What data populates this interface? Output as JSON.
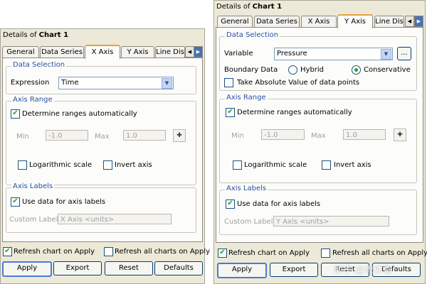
{
  "left": {
    "title_prefix": "Details of ",
    "title_bold": "Chart 1",
    "tabs": [
      "General",
      "Data Series",
      "X Axis",
      "Y Axis",
      "Line Dis"
    ],
    "active_tab": "X Axis",
    "data_selection": {
      "title": "Data Selection",
      "expression_label": "Expression",
      "expression_value": "Time"
    },
    "axis_range": {
      "title": "Axis Range",
      "auto_label": "Determine ranges automatically",
      "min_label": "Min",
      "min_value": "-1.0",
      "max_label": "Max",
      "max_value": "1.0",
      "log_label": "Logarithmic scale",
      "invert_label": "Invert axis"
    },
    "axis_labels": {
      "title": "Axis Labels",
      "use_data_label": "Use data for axis labels",
      "custom_label": "Custom Label",
      "custom_placeholder": "X Axis <units>"
    },
    "bottom": {
      "refresh_label": "Refresh chart on Apply",
      "refresh_all_label": "Refresh all charts on Apply",
      "apply": "Apply",
      "export": "Export",
      "reset": "Reset",
      "defaults": "Defaults"
    }
  },
  "right": {
    "title_prefix": "Details of ",
    "title_bold": "Chart 1",
    "tabs": [
      "General",
      "Data Series",
      "X Axis",
      "Y Axis",
      "Line Dis"
    ],
    "active_tab": "Y Axis",
    "data_selection": {
      "title": "Data Selection",
      "variable_label": "Variable",
      "variable_value": "Pressure",
      "ellipsis": "...",
      "boundary_label": "Boundary Data",
      "hybrid_label": "Hybrid",
      "conservative_label": "Conservative",
      "absolute_label": "Take Absolute Value of data points"
    },
    "axis_range": {
      "title": "Axis Range",
      "auto_label": "Determine ranges automatically",
      "min_label": "Min",
      "min_value": "-1.0",
      "max_label": "Max",
      "max_value": "1.0",
      "log_label": "Logarithmic scale",
      "invert_label": "Invert axis"
    },
    "axis_labels": {
      "title": "Axis Labels",
      "use_data_label": "Use data for axis labels",
      "custom_label": "Custom Label",
      "custom_placeholder": "Y Axis <units>"
    },
    "bottom": {
      "refresh_label": "Refresh chart on Apply",
      "refresh_all_label": "Refresh all charts on Apply",
      "apply": "Apply",
      "export": "Export",
      "reset": "Reset",
      "defaults": "Defaults"
    }
  },
  "watermark": "知乎 @流体智",
  "colors": {
    "panel_bg": "#ece9d8",
    "group_title": "#2a50a8",
    "check_mark": "#21a121",
    "active_tab_accent": "#e8a33c"
  },
  "icons": {
    "checkbox_checked": "✔",
    "dropdown": "▼",
    "tab_prev": "◀",
    "tab_next": "▶",
    "pick": "✚"
  }
}
